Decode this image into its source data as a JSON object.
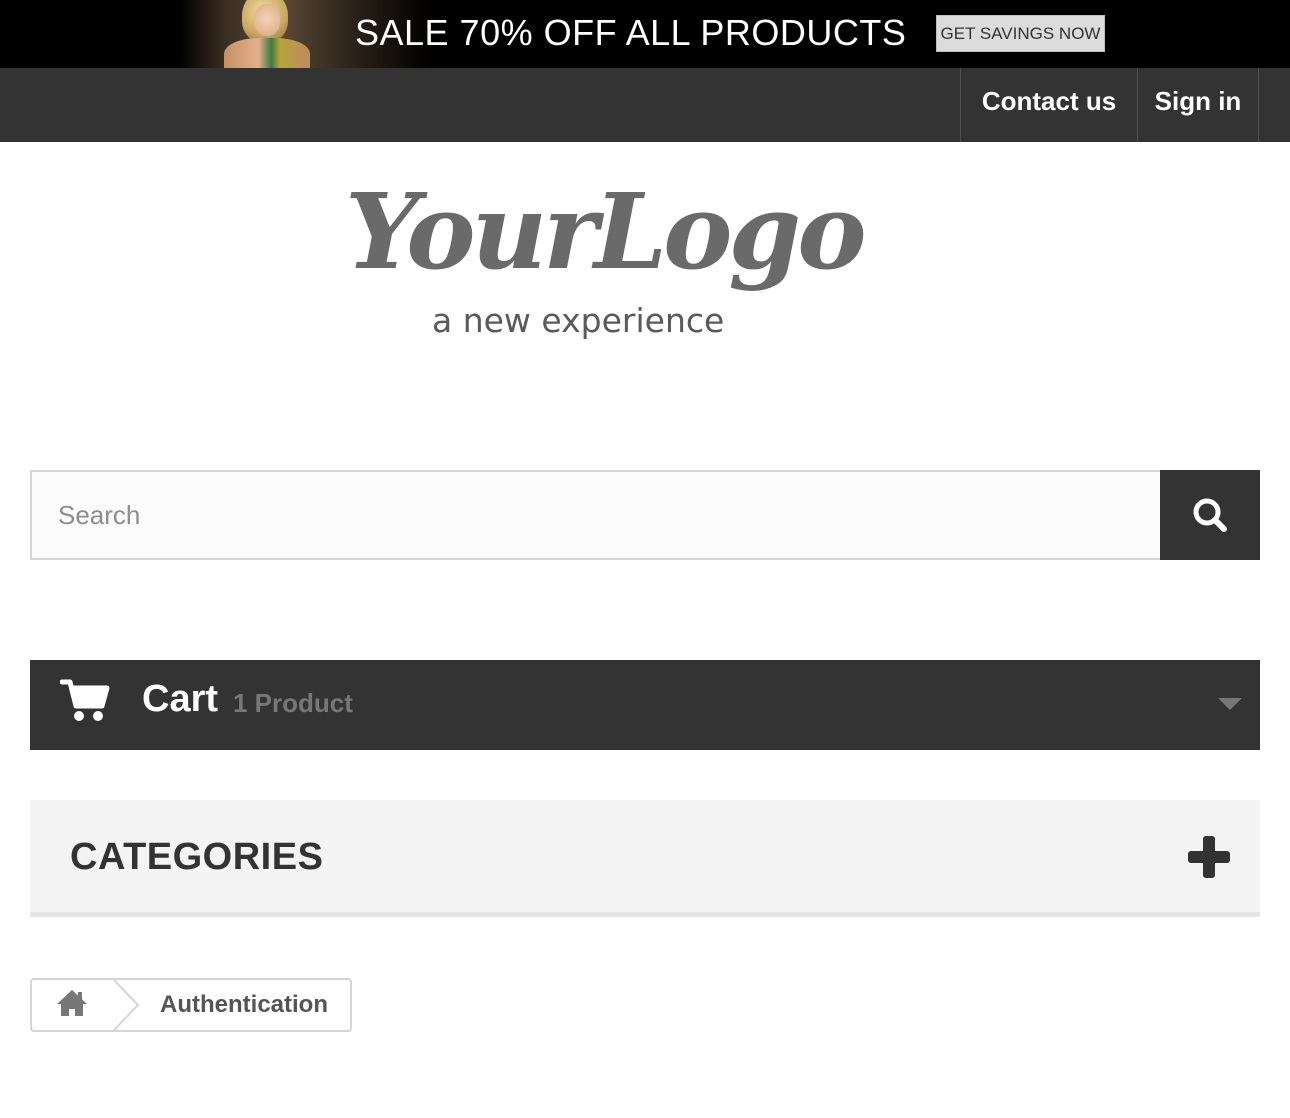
{
  "promo": {
    "text": "SALE 70% OFF ALL PRODUCTS",
    "button_label": "GET SAVINGS NOW"
  },
  "nav": {
    "contact_label": "Contact us",
    "signin_label": "Sign in"
  },
  "logo": {
    "script": "YourLogo",
    "tagline": "a new experience"
  },
  "search": {
    "placeholder": "Search",
    "value": "",
    "button_icon": "search-icon"
  },
  "cart": {
    "icon": "cart-icon",
    "title": "Cart",
    "quantity": "1 Product",
    "toggle_icon": "caret-down-icon"
  },
  "categories": {
    "title": "CATEGORIES",
    "toggle_icon": "plus-icon"
  },
  "breadcrumb": {
    "home_icon": "home-icon",
    "current": "Authentication"
  },
  "colors": {
    "dark_bar": "#333333",
    "light_panel": "#f4f4f4",
    "border": "#d6d4d4",
    "muted_text": "#777777"
  }
}
